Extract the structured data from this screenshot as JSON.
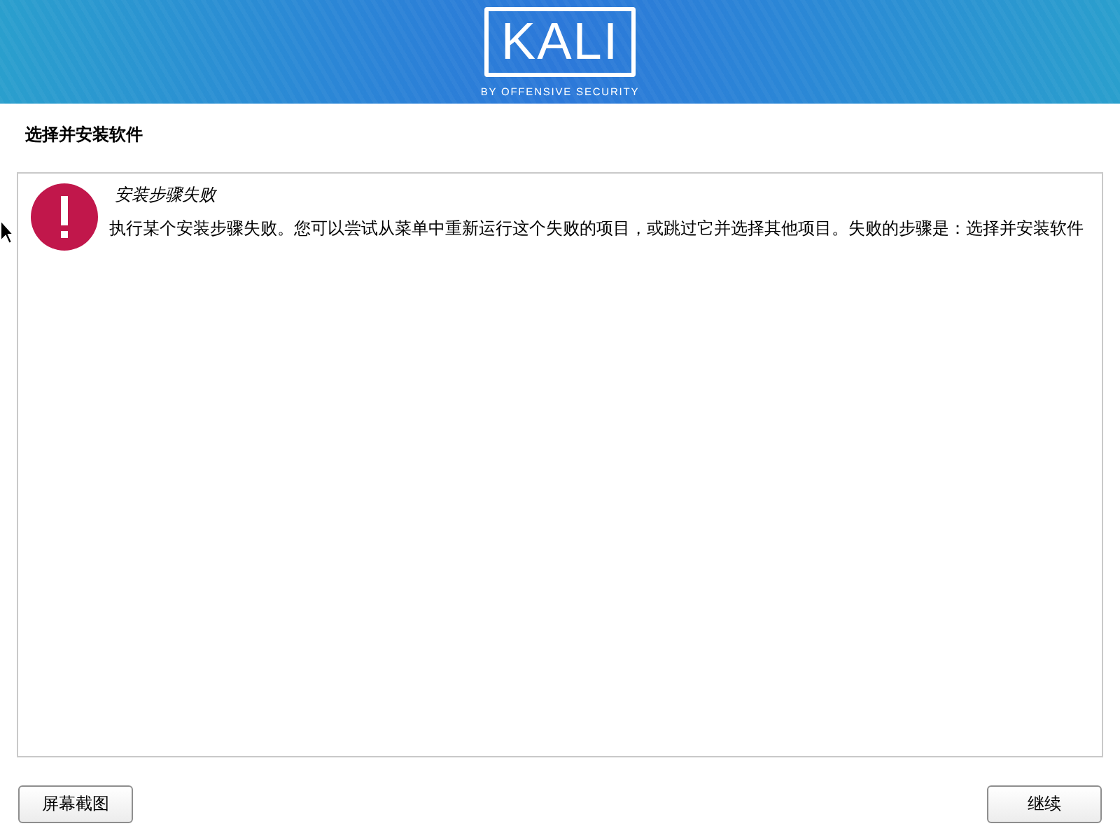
{
  "banner": {
    "logo_text": "KALI",
    "logo_tagline": "BY OFFENSIVE SECURITY"
  },
  "page_title": "选择并安装软件",
  "message": {
    "kind": "error",
    "title": "安装步骤失败",
    "text": "执行某个安装步骤失败。您可以尝试从菜单中重新运行这个失败的项目，或跳过它并选择其他项目。失败的步骤是：选择并安装软件"
  },
  "buttons": [
    {
      "label": "屏幕截图"
    },
    {
      "label": "继续"
    }
  ]
}
